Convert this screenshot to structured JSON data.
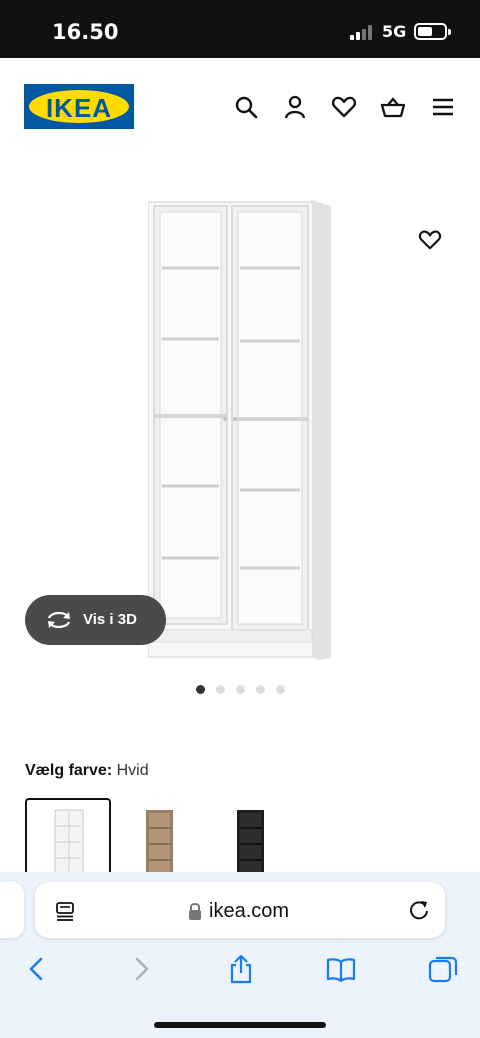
{
  "status_bar": {
    "time": "16.50",
    "network": "5G"
  },
  "header": {
    "logo_text": "IKEA",
    "icons": [
      "search-icon",
      "user-icon",
      "heart-icon",
      "basket-icon",
      "menu-icon"
    ]
  },
  "product": {
    "view_3d_label": "Vis i 3D",
    "image_count": 5,
    "active_image_index": 0
  },
  "color_select": {
    "label": "Vælg farve:",
    "value": "Hvid",
    "options": [
      {
        "name": "Hvid",
        "color": "#f4f4f2",
        "selected": true
      },
      {
        "name": "Eg",
        "color": "#9a7d62",
        "selected": false
      },
      {
        "name": "Sort",
        "color": "#2a2a2a",
        "selected": false
      }
    ]
  },
  "browser": {
    "url": "ikea.com"
  },
  "colors": {
    "ikea_blue": "#0058a3",
    "ikea_yellow": "#ffdb00",
    "safari_blue": "#1a7cf5"
  }
}
